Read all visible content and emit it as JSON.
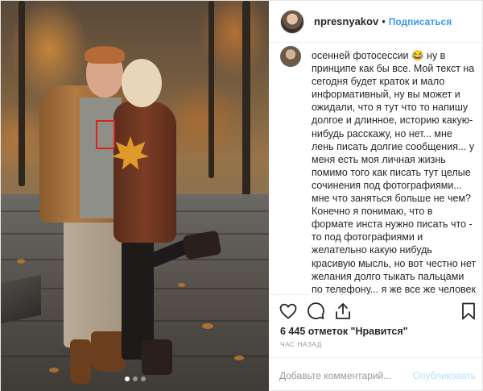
{
  "header": {
    "username": "npresnyakov",
    "separator": "•",
    "follow_label": "Подписаться"
  },
  "caption": {
    "text": "осенней фотосессии 😂 ну в принципе как бы все. Мой текст на сегодня будет краток и мало информативный, ну вы может и ожидали, что я тут что то напишу долгое и длинное, историю какую-нибудь расскажу, но нет... мне лень писать долгие сообщения... у меня есть моя личная жизнь помимо того как писать тут целые сочинения под фотографиями... мне что заняться больше не чем? Конечно я понимаю, что в формате инста нужно писать что - то под фотографиями и желательно какую нибудь красивую мысль, но вот честно нет желания долго тыкать пальцами по телефону... я же все же человек и пальцы могут устать... я вот в следующий раз лучше напишу что-то когда вдохновение будет, а"
  },
  "actions": {
    "like_icon": "heart-icon",
    "comment_icon": "comment-icon",
    "share_icon": "share-icon",
    "save_icon": "bookmark-icon"
  },
  "likes": {
    "text": "6 445 отметок \"Нравится\""
  },
  "time": {
    "text": "час назад"
  },
  "comment": {
    "placeholder": "Добавьте комментарий...",
    "publish_label": "Опубликовать"
  },
  "carousel": {
    "current": 1,
    "total": 3
  },
  "colors": {
    "link": "#3897f0",
    "publish_disabled": "#b2dffc",
    "highlight_box": "#e0201f"
  }
}
